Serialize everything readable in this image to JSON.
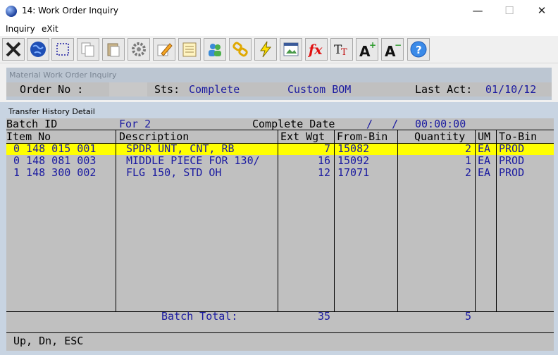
{
  "window": {
    "title": "14: Work Order Inquiry",
    "min": "—",
    "max": "☐",
    "close": "✕"
  },
  "menu": {
    "inquiry": "Inquiry",
    "exit": "eXit"
  },
  "toolbar": {
    "icons": [
      "close-x-icon",
      "globe-icon",
      "select-box-icon",
      "copy-icon",
      "paste-icon",
      "gear-icon",
      "edit-pencil-icon",
      "notepad-icon",
      "users-icon",
      "chain-link-icon",
      "lightning-icon",
      "image-list-icon",
      "function-fx-icon",
      "text-size-icon",
      "font-increase-icon",
      "font-decrease-icon",
      "help-icon"
    ]
  },
  "material_panel": {
    "title": "Material Work Order Inquiry",
    "order_label": "Order No :",
    "sts_label": "Sts:",
    "sts_value": "Complete",
    "custom_label": "Custom BOM",
    "last_act_label": "Last Act:",
    "last_act_value": "01/10/12"
  },
  "transfer_panel": {
    "title": "Transfer History Detail",
    "batch_label": "Batch ID",
    "batch_for": "For 2",
    "complete_date_label": "Complete Date",
    "complete_date_value": "/   /",
    "complete_time": "00:00:00",
    "columns": {
      "item": "Item No",
      "description": "Description",
      "ext_wgt": "Ext Wgt",
      "from_bin": "From-Bin",
      "quantity": "Quantity",
      "um": "UM",
      "to_bin": "To-Bin"
    },
    "rows": [
      {
        "item": "0 148 015 001",
        "description": "SPDR UNT, CNT, RB",
        "ext_wgt": "7",
        "from_bin": "15082",
        "quantity": "2",
        "um": "EA",
        "to_bin": "PROD"
      },
      {
        "item": "0 148 081 003",
        "description": "MIDDLE PIECE FOR 130/",
        "ext_wgt": "16",
        "from_bin": "15092",
        "quantity": "1",
        "um": "EA",
        "to_bin": "PROD"
      },
      {
        "item": "1 148 300 002",
        "description": "FLG 150, STD OH",
        "ext_wgt": "12",
        "from_bin": "17071",
        "quantity": "2",
        "um": "EA",
        "to_bin": "PROD"
      }
    ],
    "batch_total_label": "Batch Total:",
    "batch_total_wgt": "35",
    "batch_total_qty": "5",
    "status_hint": "Up, Dn, ESC"
  }
}
